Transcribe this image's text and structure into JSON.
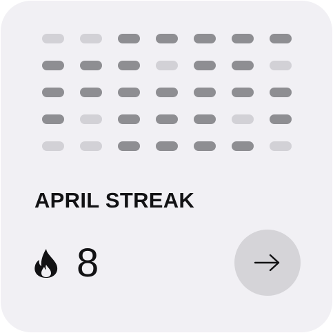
{
  "calendar": {
    "rows": [
      [
        0,
        0,
        1,
        1,
        1,
        1,
        1
      ],
      [
        1,
        1,
        1,
        0,
        1,
        1,
        0
      ],
      [
        1,
        1,
        1,
        1,
        1,
        1,
        1
      ],
      [
        1,
        0,
        1,
        1,
        1,
        0,
        1
      ],
      [
        0,
        0,
        1,
        1,
        1,
        1,
        0
      ]
    ]
  },
  "card": {
    "title": "APRIL STREAK",
    "streak_count": "8",
    "streak_icon": "flame-icon",
    "action_icon": "arrow-right-icon"
  },
  "colors": {
    "card_background": "#f1f0f4",
    "day_active": "#8e8e92",
    "day_inactive": "#d2d1d6",
    "text": "#121214",
    "button_background": "#d5d4d8"
  }
}
